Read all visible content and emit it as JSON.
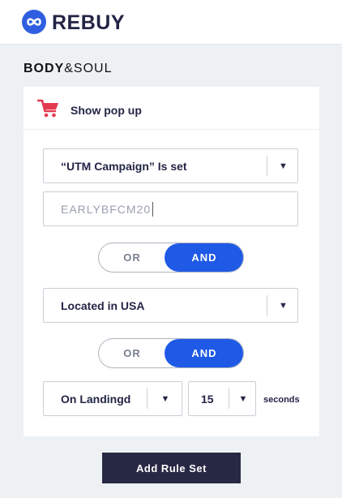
{
  "app": {
    "logo_text": "REBUY",
    "logo_icon": "infinity-icon",
    "brand_bold": "BODY",
    "brand_rest": "&SOUL"
  },
  "rule_card": {
    "header_icon": "shopping-cart-icon",
    "header_title": "Show pop up",
    "condition_1": {
      "selected": "“UTM Campaign” Is set"
    },
    "utm_value": "EARLYBFCM20",
    "toggle_1": {
      "options": [
        "OR",
        "AND"
      ],
      "selected": "AND"
    },
    "condition_2": {
      "selected": "Located in USA"
    },
    "toggle_2": {
      "options": [
        "OR",
        "AND"
      ],
      "selected": "AND"
    },
    "trigger": {
      "selected": "On Landingd"
    },
    "delay": {
      "selected": "15",
      "unit": "seconds"
    }
  },
  "actions": {
    "add_rule_set": "Add Rule Set"
  },
  "colors": {
    "accent": "#1f5ae6",
    "cart": "#e53950",
    "button_dark": "#272844",
    "background": "#edf1f4"
  }
}
